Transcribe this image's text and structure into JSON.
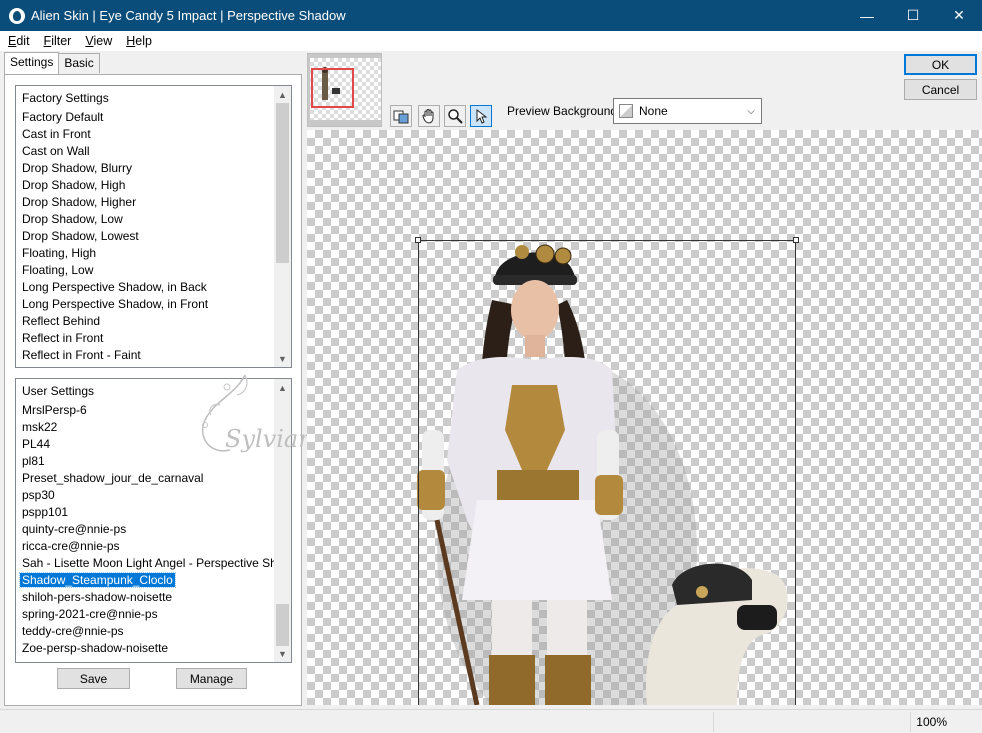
{
  "window": {
    "title": "Alien Skin | Eye Candy 5 Impact | Perspective Shadow",
    "minimize": "—",
    "maximize": "☐",
    "close": "✕"
  },
  "menu": [
    {
      "accel": "E",
      "rest": "dit"
    },
    {
      "accel": "F",
      "rest": "ilter"
    },
    {
      "accel": "V",
      "rest": "iew"
    },
    {
      "accel": "H",
      "rest": "elp"
    }
  ],
  "tabs": [
    "Settings",
    "Basic"
  ],
  "factory_settings": {
    "header": "Factory Settings",
    "items": [
      "Factory Default",
      "Cast in Front",
      "Cast on Wall",
      "Drop Shadow, Blurry",
      "Drop Shadow, High",
      "Drop Shadow, Higher",
      "Drop Shadow, Low",
      "Drop Shadow, Lowest",
      "Floating, High",
      "Floating, Low",
      "Long Perspective Shadow, in Back",
      "Long Perspective Shadow, in Front",
      "Reflect Behind",
      "Reflect in Front",
      "Reflect in Front - Faint"
    ]
  },
  "user_settings": {
    "header": "User Settings",
    "items": [
      "MrslPersp-6",
      "msk22",
      "PL44",
      "pl81",
      "Preset_shadow_jour_de_carnaval",
      "psp30",
      "pspp101",
      "quinty-cre@nnie-ps",
      "ricca-cre@nnie-ps",
      "Sah - Lisette Moon Light Angel - Perspective Shadow",
      "Shadow_Steampunk_Cloclo",
      "shiloh-pers-shadow-noisette",
      "spring-2021-cre@nnie-ps",
      "teddy-cre@nnie-ps",
      "Zoe-persp-shadow-noisette"
    ],
    "selected": "Shadow_Steampunk_Cloclo"
  },
  "buttons": {
    "save": "Save",
    "manage": "Manage",
    "ok": "OK",
    "cancel": "Cancel"
  },
  "preview": {
    "background_label": "Preview Background:",
    "background_value": "None"
  },
  "watermark": "Sylviane",
  "status": {
    "zoom": "100%"
  },
  "icons": [
    "app-icon",
    "preview-toggle-icon",
    "hand-icon",
    "zoom-icon",
    "arrow-pointer-icon",
    "chevron-down-icon"
  ]
}
